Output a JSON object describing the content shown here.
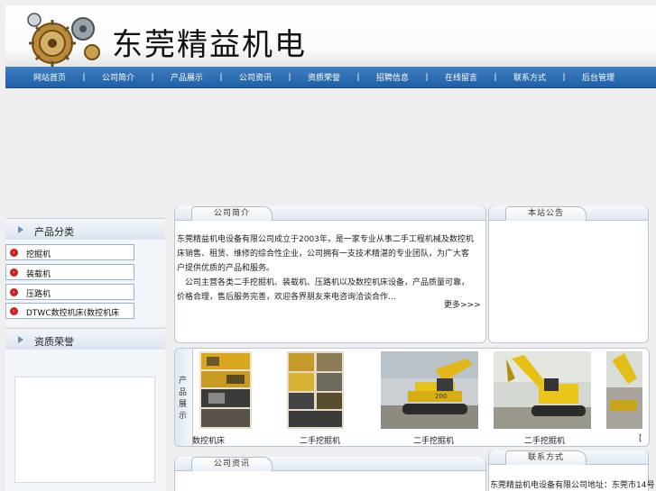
{
  "header": {
    "title": "东莞精益机电",
    "logo_icon": "gears-logo-icon"
  },
  "nav": {
    "items": [
      "网站首页",
      "公司简介",
      "产品展示",
      "公司资讯",
      "资质荣誉",
      "招聘信息",
      "在线留言",
      "联系方式",
      "后台管理"
    ],
    "separator": "|"
  },
  "sidebar": {
    "categories_title": "产品分类",
    "categories": [
      "挖掘机",
      "装载机",
      "压路机",
      "DTWC数控机床(数控机床"
    ],
    "honors_title": "资质荣誉"
  },
  "intro": {
    "tab_label": "公司简介",
    "paragraphs": [
      "东莞精益机电设备有限公司成立于2003年，是一家专业从事二手工程机械及数控机床销售、租赁、维修的综合性企业，公司拥有一支技术精湛的专业团队，为广大客户提供优质的产品和服务。",
      "公司主营各类二手挖掘机、装载机、压路机以及数控机床设备，产品质量可靠，价格合理，售后服务完善，欢迎各界朋友来电咨询洽谈合作..."
    ],
    "more_label": "更多>>>"
  },
  "notice": {
    "tab_label": "本站公告"
  },
  "products": {
    "side_label": [
      "产",
      "品",
      "展",
      "示"
    ],
    "items": [
      {
        "caption": "数控机床"
      },
      {
        "caption": "二手挖掘机"
      },
      {
        "caption": "二手挖掘机"
      },
      {
        "caption": "二手挖掘机"
      },
      {
        "caption": "["
      }
    ]
  },
  "news": {
    "tab_label": "公司资讯"
  },
  "contact": {
    "tab_label": "联系方式",
    "text": "东莞精益机电设备有限公司地址：东莞市14号"
  },
  "colors": {
    "nav": "#2a68ad",
    "sidebar": "#f2f5fa",
    "accent_red": "#d0201e",
    "excavator_yellow": "#e7c21a"
  }
}
